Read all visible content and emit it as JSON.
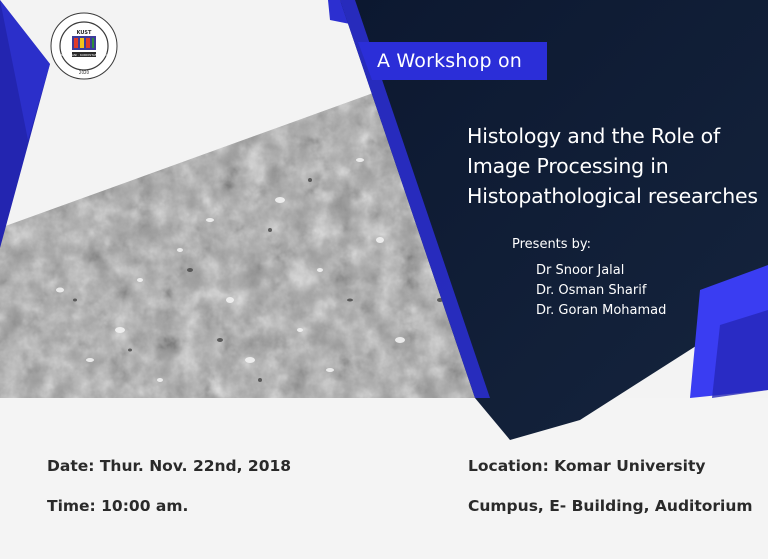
{
  "header": {
    "banner": "A  Workshop on",
    "title_lines": [
      "Histology and the Role of",
      "Image Processing in",
      "Histopathological researches"
    ],
    "presents_label": "Presents by:",
    "presenters": [
      "Dr Snoor Jalal",
      "Dr. Osman Sharif",
      "Dr. Goran Mohamad"
    ]
  },
  "footer": {
    "date": "Date:  Thur.  Nov. 22nd, 2018",
    "time": "Time: 10:00 am.",
    "location": "Location: Komar University",
    "venue": "Cumpus, E- Building, Auditorium"
  },
  "logo": {
    "name": "university-seal",
    "arc_text": "KOMAR UNIVERSITY OF SCIENCE AND TECHNOLOGY",
    "center_text": "KUST",
    "lower_text": "SULEIMANI · KURDISTAN · IRAQ",
    "year": "2020"
  },
  "colors": {
    "navy": "#0f1c33",
    "royal_blue": "#2427b6",
    "bright_blue": "#3a3df2",
    "background": "#f3f3f3",
    "text": "#2a2a2a"
  }
}
